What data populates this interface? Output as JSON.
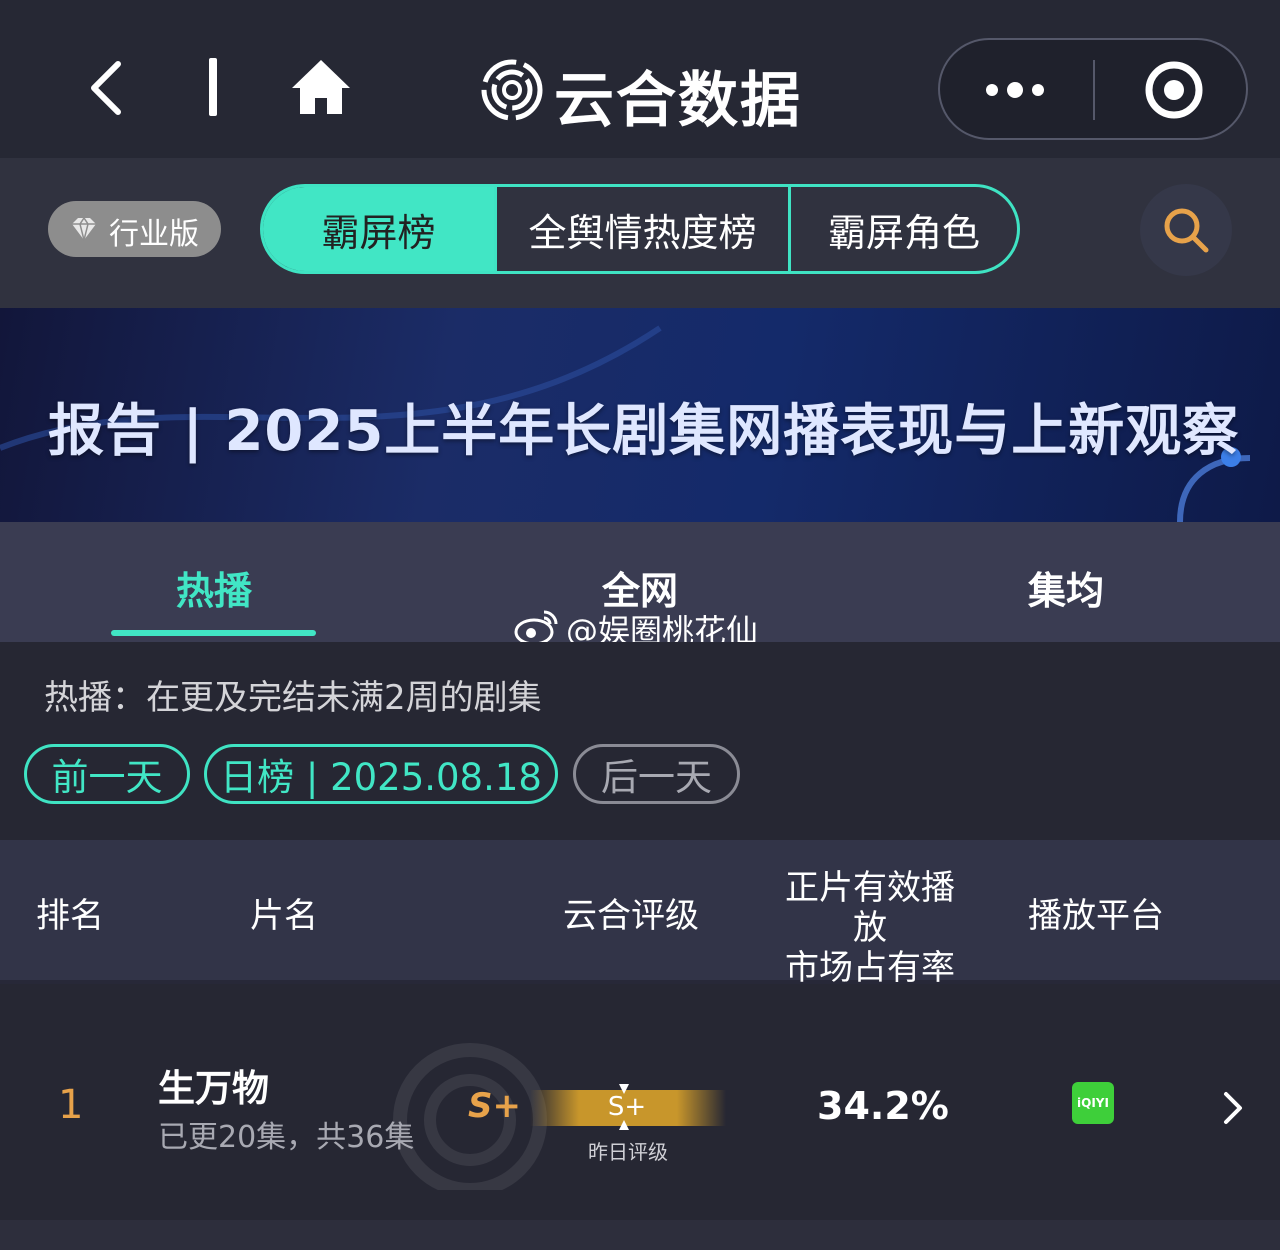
{
  "app": {
    "title": "云合数据"
  },
  "filter": {
    "edition_badge": "行业版",
    "segments": [
      "霸屏榜",
      "全舆情热度榜",
      "霸屏角色"
    ],
    "active_segment": "霸屏榜"
  },
  "banner": {
    "text": "报告 | 2025上半年长剧集网播表现与上新观察"
  },
  "tabs": {
    "items": [
      "热播",
      "全网",
      "集均"
    ],
    "active": "热播"
  },
  "watermark": "@娱圈桃花仙",
  "description": "热播：在更及完结未满2周的剧集",
  "date_nav": {
    "prev": "前一天",
    "current": "日榜 | 2025.08.18",
    "next": "后一天"
  },
  "table": {
    "headers": {
      "rank": "排名",
      "name": "片名",
      "grade": "云合评级",
      "share": "正片有效播放\n市场占有率",
      "platform": "播放平台"
    },
    "rows": [
      {
        "rank": "1",
        "title": "生万物",
        "episodes": "已更20集，共36集",
        "grade": "S+",
        "prev_grade": "S+",
        "prev_grade_label": "昨日评级",
        "share": "34.2%",
        "platform": "iQIYI"
      }
    ]
  },
  "colors": {
    "accent": "#41e6c5",
    "rank": "#e7a24a",
    "background": "#262733",
    "header_bg": "#323448"
  },
  "icons": [
    "back-icon",
    "home-icon",
    "logo-icon",
    "more-icon",
    "target-icon",
    "diamond-icon",
    "search-icon",
    "weibo-icon",
    "chevron-right-icon"
  ]
}
